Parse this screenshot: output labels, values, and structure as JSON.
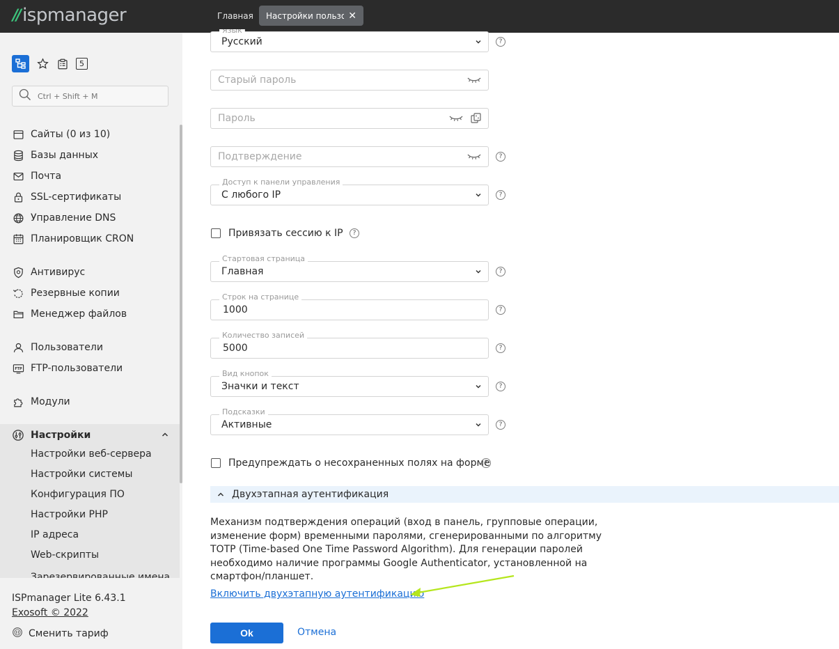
{
  "topbar": {
    "logo_slashes": "//",
    "logo_text": "ispmanager",
    "tabs": [
      {
        "label": "Главная"
      },
      {
        "label": "Настройки пользо..."
      }
    ],
    "close_glyph": "✕"
  },
  "sidebar": {
    "tools": [
      "tree-icon",
      "star-icon",
      "clipboard-icon"
    ],
    "counter_badge": "5",
    "search_placeholder": "Ctrl + Shift + M",
    "items": [
      {
        "label": "Сайты (0 из 10)",
        "icon": "sites-icon"
      },
      {
        "label": "Базы данных",
        "icon": "database-icon"
      },
      {
        "label": "Почта",
        "icon": "mail-icon"
      },
      {
        "label": "SSL-сертификаты",
        "icon": "lock-icon"
      },
      {
        "label": "Управление DNS",
        "icon": "globe-icon"
      },
      {
        "label": "Планировщик CRON",
        "icon": "calendar-icon"
      },
      {
        "label": "Антивирус",
        "icon": "shield-icon"
      },
      {
        "label": "Резервные копии",
        "icon": "backup-icon"
      },
      {
        "label": "Менеджер файлов",
        "icon": "folder-icon"
      },
      {
        "label": "Пользователи",
        "icon": "user-icon"
      },
      {
        "label": "FTP-пользователи",
        "icon": "ftp-icon"
      },
      {
        "label": "Модули",
        "icon": "puzzle-icon"
      },
      {
        "label": "Настройки",
        "icon": "settings-icon"
      }
    ],
    "settings_sub": [
      "Настройки веб-сервера",
      "Настройки системы",
      "Конфигурация ПО",
      "Настройки PHP",
      "IP адреса",
      "Web-скрипты",
      "Зарезервированные имена"
    ],
    "footer": {
      "version": "ISPmanager Lite 6.43.1",
      "copyright": "Exosoft © 2022",
      "tariff": "Сменить тариф"
    }
  },
  "form": {
    "language": {
      "label": "Язык",
      "value": "Русский"
    },
    "old_password": {
      "placeholder": "Старый пароль"
    },
    "password": {
      "placeholder": "Пароль"
    },
    "confirm": {
      "placeholder": "Подтверждение"
    },
    "access": {
      "label": "Доступ к панели управления",
      "value": "С любого IP"
    },
    "bind_session": {
      "label": "Привязать сессию к IP",
      "checked": false
    },
    "start_page": {
      "label": "Стартовая страница",
      "value": "Главная"
    },
    "rows_per_page": {
      "label": "Строк на странице",
      "value": "1000"
    },
    "records_count": {
      "label": "Количество записей",
      "value": "5000"
    },
    "buttons_view": {
      "label": "Вид кнопок",
      "value": "Значки и текст"
    },
    "hints": {
      "label": "Подсказки",
      "value": "Активные"
    },
    "warn_unsaved": {
      "label": "Предупреждать о несохраненных полях на форме",
      "checked": false
    },
    "help_glyph": "?",
    "twofa": {
      "section_title": "Двухэтапная аутентификация",
      "description": "Механизм подтверждения операций (вход в панель, групповые операции, изменение форм) временными паролями, сгенерированными по алгоритму TOTP (Time-based One Time Password Algorithm). Для генерации паролей необходимо наличие программы Google Authenticator, установленной на смартфон/планшет.",
      "enable_link": "Включить двухэтапную аутентификацию"
    },
    "ok_label": "Ok",
    "cancel_label": "Отмена"
  },
  "colors": {
    "accent": "#1b6fd6",
    "topbar": "#2b2b2b",
    "arrow": "#b5e61d",
    "section_bg": "#eaf3fc"
  }
}
